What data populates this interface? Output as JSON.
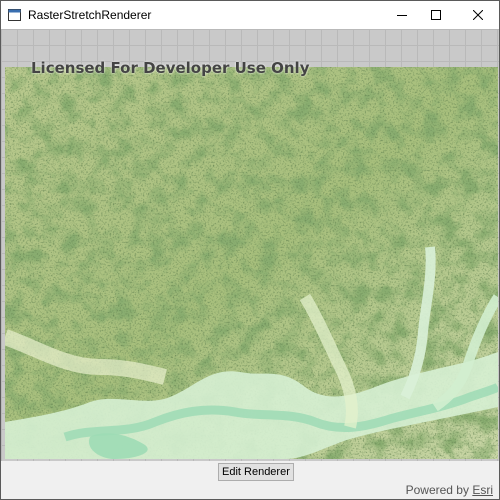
{
  "window": {
    "title": "RasterStretchRenderer",
    "icon": "window-app-icon",
    "controls": [
      "minimize-icon",
      "maximize-icon",
      "close-icon"
    ]
  },
  "map": {
    "license_text": "Licensed For Developer Use Only",
    "content": "shaded-relief-raster"
  },
  "toolbar": {
    "edit_button_label": "Edit Renderer"
  },
  "attribution": {
    "prefix": "Powered by",
    "link_text": "Esri"
  },
  "colors": {
    "vegetation": "#5f8f3a",
    "highlight": "#f1f4dc",
    "water": "#9ddbb5",
    "shadow": "#2c4a1d"
  }
}
